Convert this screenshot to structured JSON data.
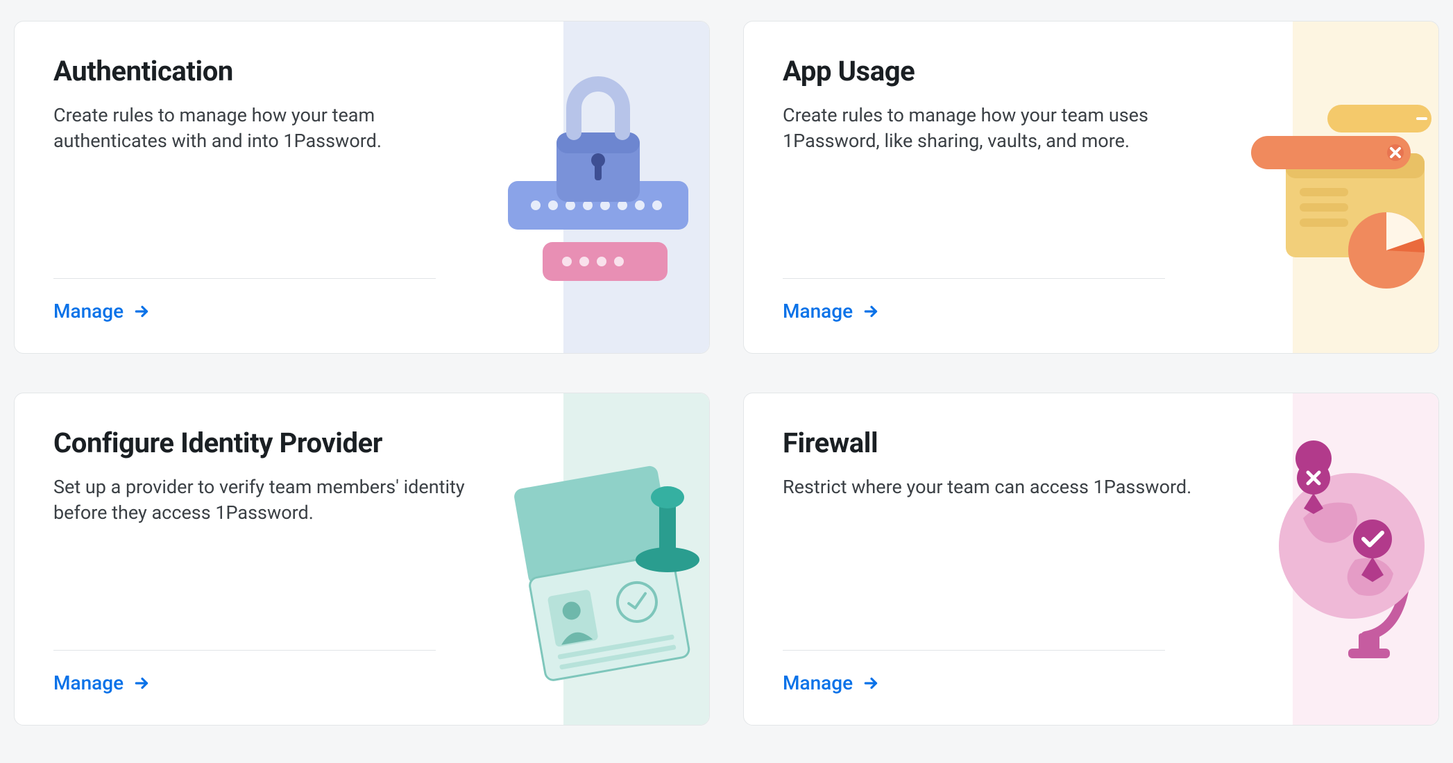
{
  "cards": [
    {
      "id": "authentication",
      "title": "Authentication",
      "description": "Create rules to manage how your team authenticates with and into 1Password.",
      "manage_label": "Manage",
      "illustration": "padlock-icon",
      "accent_color": "#e7ecf7"
    },
    {
      "id": "app-usage",
      "title": "App Usage",
      "description": "Create rules to manage how your team uses 1Password, like sharing, vaults, and more.",
      "manage_label": "Manage",
      "illustration": "pie-chart-tabs-icon",
      "accent_color": "#fdf5e1"
    },
    {
      "id": "identity-provider",
      "title": "Configure Identity Provider",
      "description": "Set up a provider to verify team members' identity before they access 1Password.",
      "manage_label": "Manage",
      "illustration": "passport-stamp-icon",
      "accent_color": "#e2f2ee"
    },
    {
      "id": "firewall",
      "title": "Firewall",
      "description": "Restrict where your team can access 1Password.",
      "manage_label": "Manage",
      "illustration": "globe-pin-icon",
      "accent_color": "#fceef5"
    }
  ],
  "link_color": "#0a72e8"
}
